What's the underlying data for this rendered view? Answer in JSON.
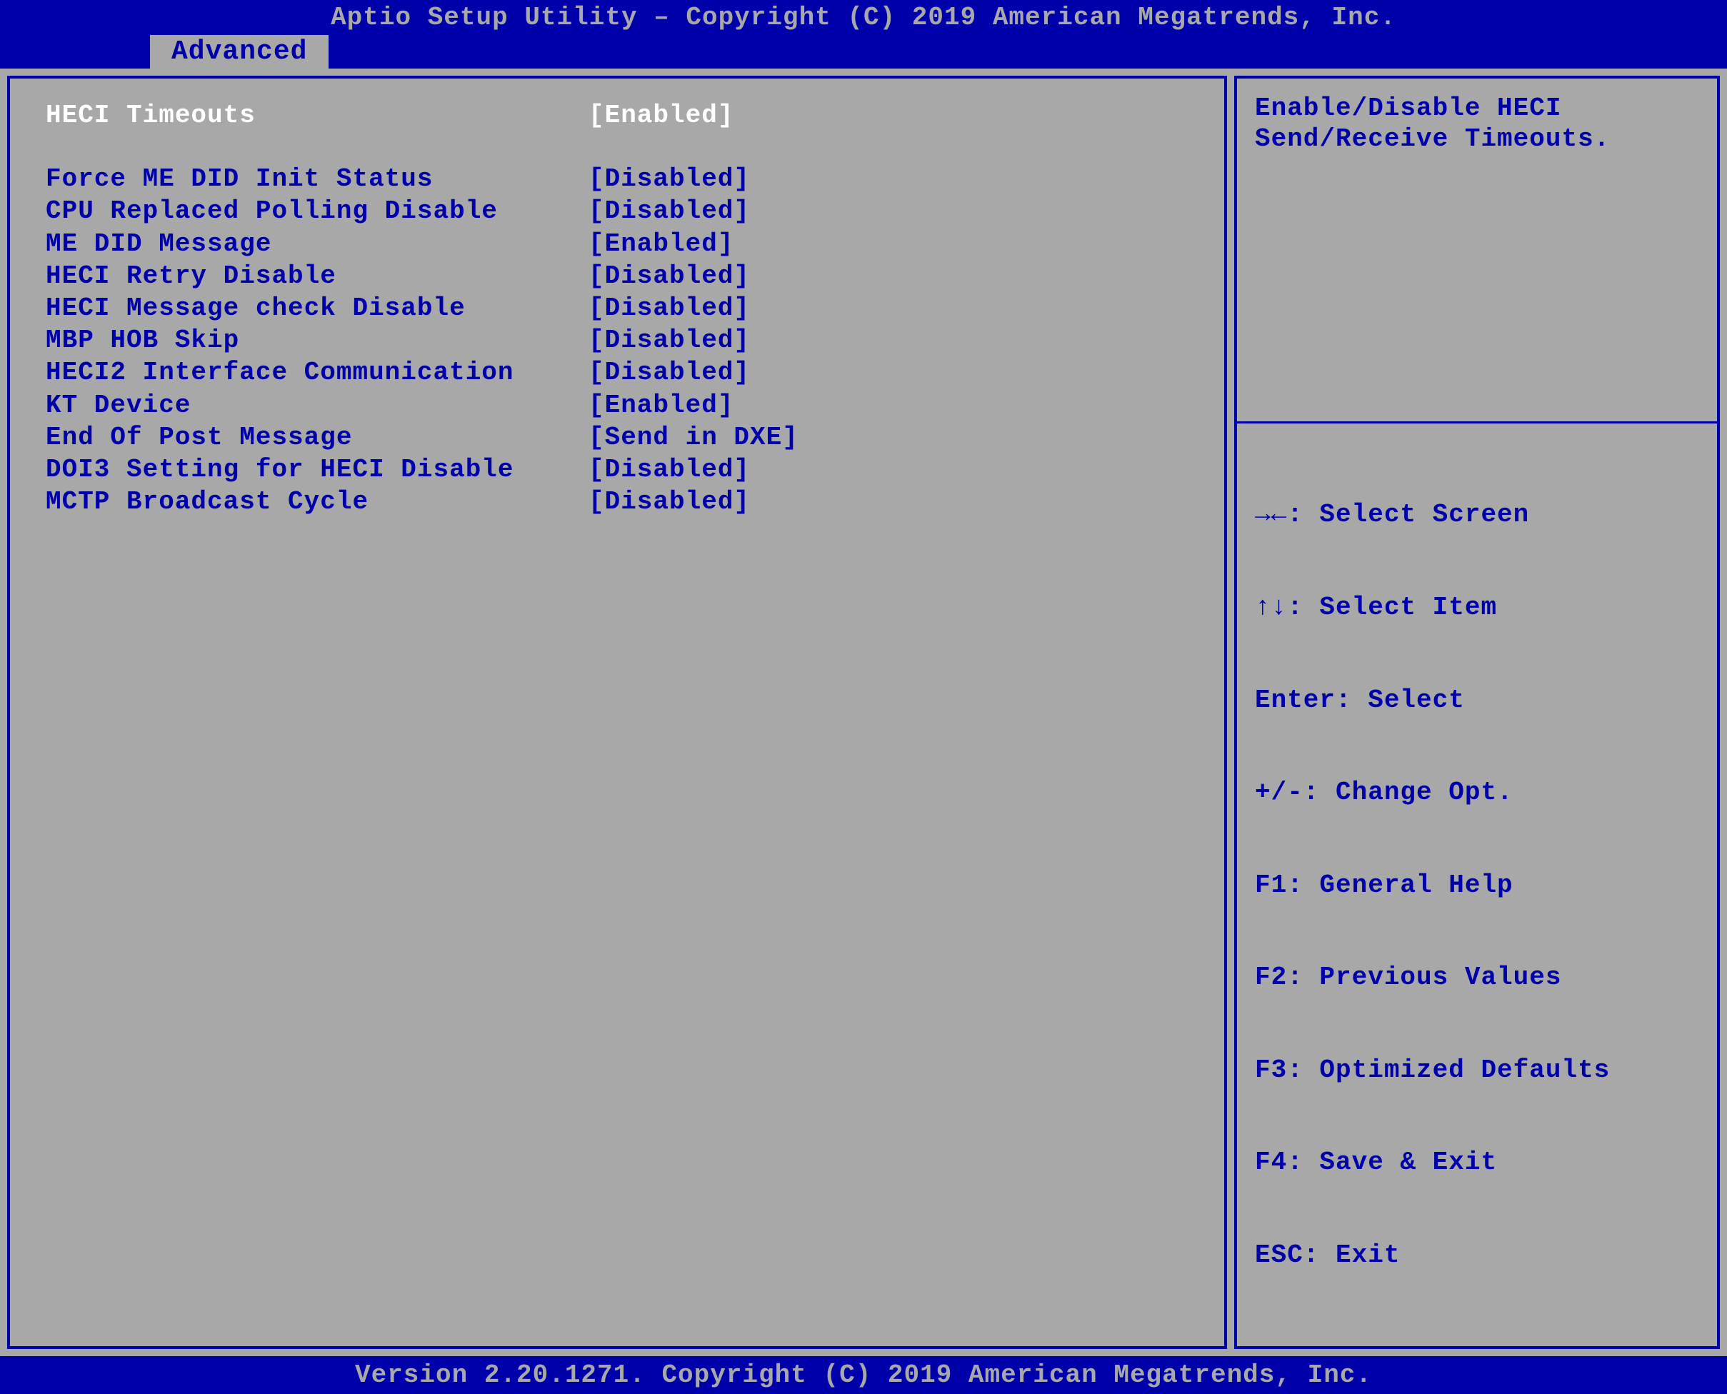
{
  "header": {
    "title": "Aptio Setup Utility – Copyright (C) 2019 American Megatrends, Inc."
  },
  "tabs": {
    "active": "Advanced"
  },
  "settings": [
    {
      "label": "HECI Timeouts",
      "value": "[Enabled]",
      "selected": true
    },
    {
      "label": "Force ME DID Init Status",
      "value": "[Disabled]",
      "selected": false
    },
    {
      "label": "CPU Replaced Polling Disable",
      "value": "[Disabled]",
      "selected": false
    },
    {
      "label": "ME DID Message",
      "value": "[Enabled]",
      "selected": false
    },
    {
      "label": "HECI Retry Disable",
      "value": "[Disabled]",
      "selected": false
    },
    {
      "label": "HECI Message check Disable",
      "value": "[Disabled]",
      "selected": false
    },
    {
      "label": "MBP HOB Skip",
      "value": "[Disabled]",
      "selected": false
    },
    {
      "label": "HECI2 Interface Communication",
      "value": "[Disabled]",
      "selected": false
    },
    {
      "label": "KT Device",
      "value": "[Enabled]",
      "selected": false
    },
    {
      "label": "End Of Post Message",
      "value": "[Send in DXE]",
      "selected": false
    },
    {
      "label": "DOI3 Setting for HECI Disable",
      "value": "[Disabled]",
      "selected": false
    },
    {
      "label": "MCTP Broadcast Cycle",
      "value": "[Disabled]",
      "selected": false
    }
  ],
  "help": {
    "line1": "Enable/Disable HECI",
    "line2": "Send/Receive Timeouts."
  },
  "legend": {
    "k1": "→←: Select Screen",
    "k2": "↑↓: Select Item",
    "k3": "Enter: Select",
    "k4": "+/-: Change Opt.",
    "k5": "F1: General Help",
    "k6": "F2: Previous Values",
    "k7": "F3: Optimized Defaults",
    "k8": "F4: Save & Exit",
    "k9": "ESC: Exit"
  },
  "footer": {
    "text": "Version 2.20.1271. Copyright (C) 2019 American Megatrends, Inc."
  }
}
